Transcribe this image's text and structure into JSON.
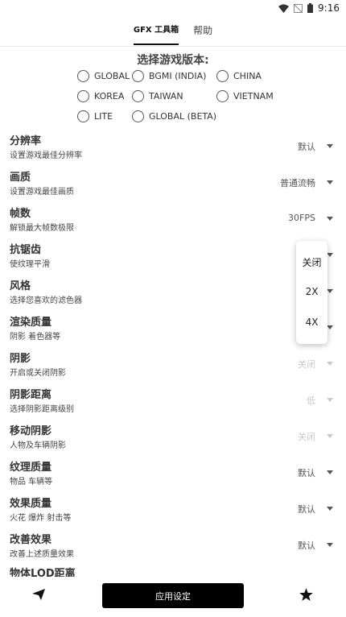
{
  "status_bar": {
    "time": "9:16",
    "icons": [
      "wifi-icon",
      "no-signal-icon",
      "battery-icon"
    ]
  },
  "tabs": [
    {
      "label": "GFX 工具箱",
      "active": true
    },
    {
      "label": "帮助",
      "active": false
    }
  ],
  "version_select": {
    "title": "选择游戏版本:",
    "options": [
      "GLOBAL",
      "BGMI (INDIA)",
      "CHINA",
      "KOREA",
      "TAIWAN",
      "VIETNAM",
      "LITE",
      "GLOBAL (BETA)"
    ]
  },
  "settings": [
    {
      "title": "分辨率",
      "desc": "设置游戏最佳分辨率",
      "value": "默认",
      "disabled": false
    },
    {
      "title": "画质",
      "desc": "设置游戏最佳画质",
      "value": "普通流畅",
      "disabled": false
    },
    {
      "title": "帧数",
      "desc": "解锁最大帧数极限",
      "value": "30FPS",
      "disabled": false
    },
    {
      "title": "抗锯齿",
      "desc": "使纹理平滑",
      "value": "",
      "disabled": false
    },
    {
      "title": "风格",
      "desc": "选择您喜欢的滤色器",
      "value": "",
      "disabled": false
    },
    {
      "title": "渲染质量",
      "desc": "阴影 着色器等",
      "value": "",
      "disabled": false
    },
    {
      "title": "阴影",
      "desc": "开启或关闭阴影",
      "value": "关闭",
      "disabled": true
    },
    {
      "title": "阴影距离",
      "desc": "选择阴影距离级别",
      "value": "低",
      "disabled": true
    },
    {
      "title": "移动阴影",
      "desc": "人物及车辆阴影",
      "value": "关闭",
      "disabled": true
    },
    {
      "title": "纹理质量",
      "desc": "物品 车辆等",
      "value": "默认",
      "disabled": false
    },
    {
      "title": "效果质量",
      "desc": "火花 爆炸 射击等",
      "value": "默认",
      "disabled": false
    },
    {
      "title": "改善效果",
      "desc": "改善上述质量效果",
      "value": "默认",
      "disabled": false
    },
    {
      "title": "物体LOD距离",
      "desc": "",
      "value": "",
      "disabled": false
    }
  ],
  "dropdown_popup": {
    "options": [
      "关闭",
      "2X",
      "4X"
    ]
  },
  "bottom_bar": {
    "apply_label": "应用设定",
    "left_icon": "send-icon",
    "right_icon": "star-icon"
  }
}
